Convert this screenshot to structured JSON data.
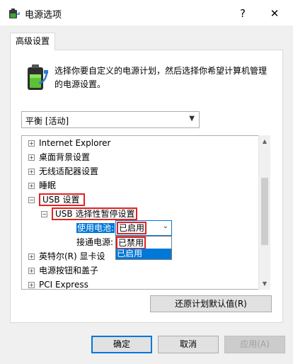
{
  "window": {
    "title": "电源选项",
    "help_glyph": "?",
    "close_glyph": "✕",
    "app_icon": "power-options-icon"
  },
  "tab": {
    "label": "高级设置"
  },
  "description": "选择你要自定义的电源计划，然后选择你希望计算机管理的电源设置。",
  "plan_select": {
    "value": "平衡 [活动]"
  },
  "tree": {
    "items": [
      {
        "label": "Internet Explorer",
        "toggle": "+"
      },
      {
        "label": "桌面背景设置",
        "toggle": "+"
      },
      {
        "label": "无线适配器设置",
        "toggle": "+"
      },
      {
        "label": "睡眠",
        "toggle": "+"
      },
      {
        "label": "USB 设置",
        "toggle": "−"
      },
      {
        "label": "USB 选择性暂停设置",
        "toggle": "−"
      },
      {
        "label": "英特尔(R) 显卡设",
        "toggle": "+"
      },
      {
        "label": "电源按钮和盖子",
        "toggle": "+"
      },
      {
        "label": "PCI Express",
        "toggle": "+"
      }
    ],
    "battery_label": "使用电池:",
    "battery_value": "已启用",
    "plugged_label": "接通电源:",
    "dropdown_options": [
      "已禁用",
      "已启用"
    ]
  },
  "buttons": {
    "restore": "还原计划默认值(R)",
    "ok": "确定",
    "cancel": "取消",
    "apply": "应用(A)"
  },
  "colors": {
    "highlight": "#0078d7",
    "annotation_red": "#e32222"
  }
}
